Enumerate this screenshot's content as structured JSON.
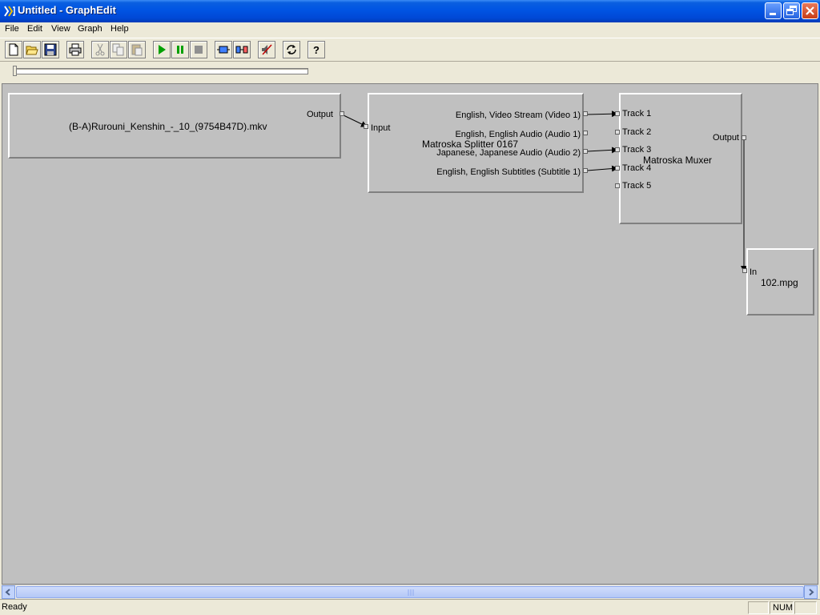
{
  "window": {
    "title": "Untitled - GraphEdit"
  },
  "menu": {
    "items": [
      "File",
      "Edit",
      "View",
      "Graph",
      "Help"
    ]
  },
  "toolbar": {
    "buttons": [
      "new-icon",
      "open-icon",
      "save-icon",
      "print-icon",
      "cut-icon",
      "copy-icon",
      "paste-icon",
      "play-icon",
      "pause-icon",
      "stop-icon",
      "filter-icon",
      "connect-icon",
      "mute-icon",
      "refresh-icon",
      "help-icon"
    ]
  },
  "seek": {
    "position": 0
  },
  "graph": {
    "source": {
      "name": "(B-A)Rurouni_Kenshin_-_10_(9754B47D).mkv",
      "output_pin": "Output"
    },
    "splitter": {
      "name": "Matroska Splitter 0167",
      "input_pin": "Input",
      "outputs": [
        "English, Video Stream (Video 1)",
        "English, English Audio (Audio 1)",
        "Japanese, Japanese Audio (Audio 2)",
        "English, English Subtitles (Subtitle 1)"
      ]
    },
    "muxer": {
      "name": "Matroska Muxer",
      "inputs": [
        "Track 1",
        "Track 2",
        "Track 3",
        "Track 4",
        "Track 5"
      ],
      "output_pin": "Output"
    },
    "writer": {
      "name": "102.mpg",
      "input_pin": "In"
    }
  },
  "status": {
    "text": "Ready",
    "num": "NUM"
  },
  "colors": {
    "canvas": "#c0c0c0",
    "titlebar": "#0054e3",
    "chrome": "#ece9d8"
  }
}
